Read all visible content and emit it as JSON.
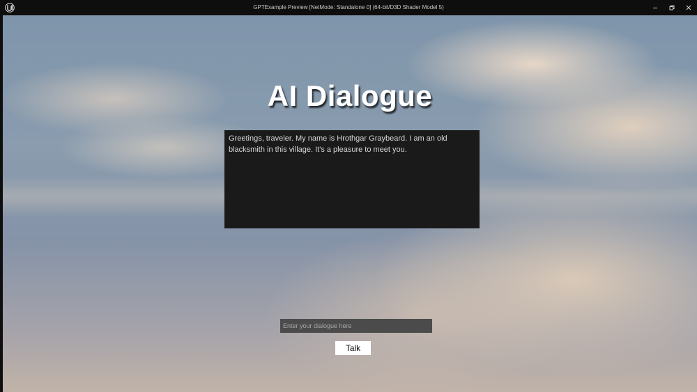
{
  "window": {
    "title": "GPTExample Preview [NetMode: Standalone 0]  (64-bit/D3D Shader Model 5)",
    "app_icon": "unreal-engine-icon",
    "controls": {
      "minimize_icon": "minimize-icon",
      "restore_icon": "restore-icon",
      "close_icon": "close-icon"
    }
  },
  "game_ui": {
    "heading": "AI Dialogue",
    "dialogue_text": "Greetings, traveler. My name is Hrothgar Graybeard. I am an old blacksmith in this village. It's a pleasure to meet you.",
    "input": {
      "placeholder": "Enter your dialogue here",
      "value": ""
    },
    "talk_button_label": "Talk"
  },
  "colors": {
    "titlebar_bg": "#0e0e0e",
    "dialogue_box_bg": "#1a1a1a",
    "input_bg": "#4b4b4b",
    "button_bg": "#ffffff"
  }
}
